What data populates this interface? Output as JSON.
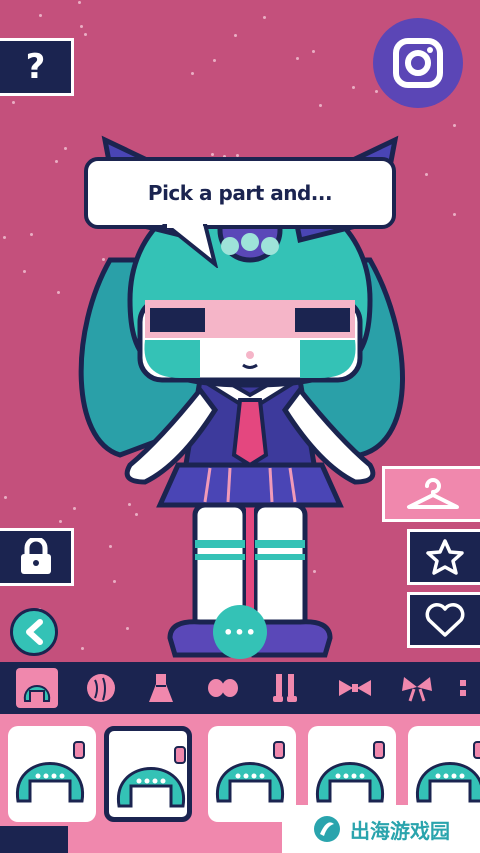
{
  "speech_bubble": {
    "text": "Pick a part and..."
  },
  "help_button": {
    "label": "?"
  },
  "more_button": {
    "label": "•••"
  },
  "watermark": {
    "text": "出海游戏园"
  },
  "colors": {
    "background": "#c4507c",
    "navy": "#1b2450",
    "teal": "#34c2b6",
    "pink": "#f088ad",
    "purple": "#5a48b8",
    "instagram_purple": "#5b46b6"
  },
  "right_buttons": [
    {
      "name": "wardrobe",
      "icon": "hanger-icon"
    },
    {
      "name": "favorite",
      "icon": "star-icon"
    },
    {
      "name": "like",
      "icon": "heart-icon"
    }
  ],
  "category_tabs": [
    {
      "name": "hair-front",
      "icon": "hair-front-icon",
      "selected": true
    },
    {
      "name": "hair-back",
      "icon": "hair-back-icon"
    },
    {
      "name": "dress",
      "icon": "dress-icon"
    },
    {
      "name": "shoes",
      "icon": "shoes-icon"
    },
    {
      "name": "socks",
      "icon": "socks-icon"
    },
    {
      "name": "ribbon",
      "icon": "ribbon-icon"
    },
    {
      "name": "bow",
      "icon": "bow-icon"
    },
    {
      "name": "accessory",
      "icon": "accessory-icon"
    }
  ],
  "hair_options": [
    {
      "name": "hair-option-1",
      "selected": false
    },
    {
      "name": "hair-option-2",
      "selected": true
    },
    {
      "name": "hair-option-3",
      "selected": false
    },
    {
      "name": "hair-option-4",
      "selected": false
    },
    {
      "name": "hair-option-5",
      "selected": false
    }
  ]
}
